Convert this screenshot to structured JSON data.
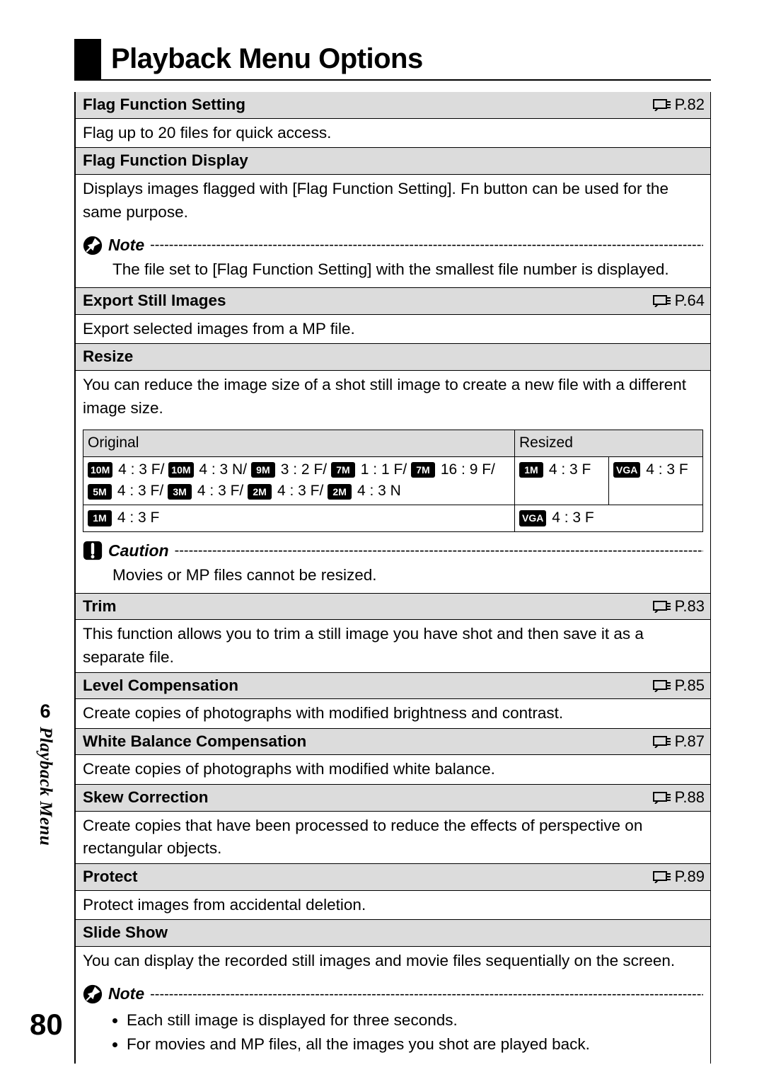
{
  "chapter": {
    "num": "6",
    "label": "Playback Menu"
  },
  "page_num": "80",
  "title": "Playback Menu Options",
  "dash_fill": "-----------------------------------------------------------------------------------------------------------------------------------",
  "items": {
    "flag_set": {
      "head": "Flag Function Setting",
      "ref": "P.82",
      "body": "Flag up to 20 files for quick access."
    },
    "flag_disp": {
      "head": "Flag Function Display",
      "body": "Displays images flagged with [Flag Function Setting]. Fn button can be used for the same purpose."
    },
    "flag_note": {
      "label": "Note",
      "body": "The file set to [Flag Function Setting] with the smallest file number is displayed."
    },
    "export": {
      "head": "Export Still Images",
      "ref": "P.64",
      "body": "Export selected images from a MP file."
    },
    "resize": {
      "head": "Resize",
      "body": "You can reduce the image size of a shot still image to create a new file with a different image size."
    },
    "resize_table": {
      "col_original": "Original",
      "col_resized": "Resized",
      "rows": [
        {
          "orig": [
            {
              "b": "10M",
              "r": "4 : 3 F/"
            },
            {
              "b": "10M",
              "r": "4 : 3 N/"
            },
            {
              "b": "9M",
              "r": "3 : 2 F/"
            },
            {
              "b": "7M",
              "r": "1 : 1 F/"
            },
            {
              "b": "7M",
              "r": "16 : 9 F/"
            },
            {
              "b": "5M",
              "r": "4 : 3 F/"
            },
            {
              "b": "3M",
              "r": "4 : 3 F/"
            },
            {
              "b": "2M",
              "r": "4 : 3 F/"
            },
            {
              "b": "2M",
              "r": "4 : 3 N"
            }
          ],
          "res1": {
            "b": "1M",
            "r": "4 : 3 F"
          },
          "res2": {
            "b": "VGA",
            "r": "4 : 3 F"
          }
        },
        {
          "orig": [
            {
              "b": "1M",
              "r": "4 : 3 F"
            }
          ],
          "res1": {
            "b": "VGA",
            "r": "4 : 3 F"
          },
          "res2": null
        }
      ]
    },
    "resize_caution": {
      "label": "Caution",
      "body": "Movies or MP files cannot be resized."
    },
    "trim": {
      "head": "Trim",
      "ref": "P.83",
      "body": "This function allows you to trim a still image you have shot and then save it as a separate file."
    },
    "level": {
      "head": "Level Compensation",
      "ref": "P.85",
      "body": "Create copies of photographs with modified brightness and contrast."
    },
    "wb": {
      "head": "White Balance Compensation",
      "ref": "P.87",
      "body": "Create copies of photographs with modified white balance."
    },
    "skew": {
      "head": "Skew Correction",
      "ref": "P.88",
      "body": "Create copies that have been processed to reduce the effects of perspective on rectangular objects."
    },
    "protect": {
      "head": "Protect",
      "ref": "P.89",
      "body": "Protect images from accidental deletion."
    },
    "slide": {
      "head": "Slide Show",
      "body": "You can display the recorded still images and movie files sequentially on the screen."
    },
    "slide_note": {
      "label": "Note",
      "b1": "Each still image is displayed for three seconds.",
      "b2": "For movies and MP files, all the images you shot are played back."
    }
  }
}
